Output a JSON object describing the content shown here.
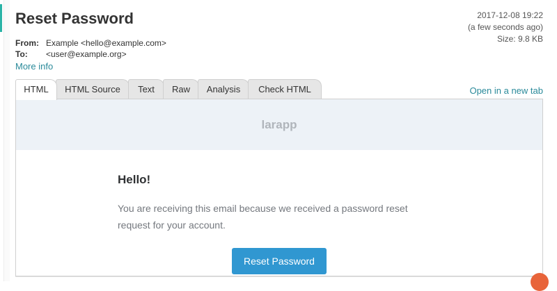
{
  "message": {
    "subject": "Reset Password",
    "from_label": "From:",
    "from_value": "Example <hello@example.com>",
    "to_label": "To:",
    "to_value": "<user@example.org>",
    "more_info": "More info",
    "date": "2017-12-08 19:22",
    "relative_time": "(a few seconds ago)",
    "size": "Size: 9.8 KB"
  },
  "tabs": [
    "HTML",
    "HTML Source",
    "Text",
    "Raw",
    "Analysis",
    "Check HTML"
  ],
  "active_tab": "HTML",
  "open_new_tab": "Open in a new tab",
  "email": {
    "brand": "larapp",
    "greeting": "Hello!",
    "body": "You are receiving this email because we received a password reset request for your account.",
    "button_label": "Reset Password"
  },
  "colors": {
    "accent": "#2ab3a6",
    "link": "#2a8a9a",
    "button": "#3097d1"
  }
}
